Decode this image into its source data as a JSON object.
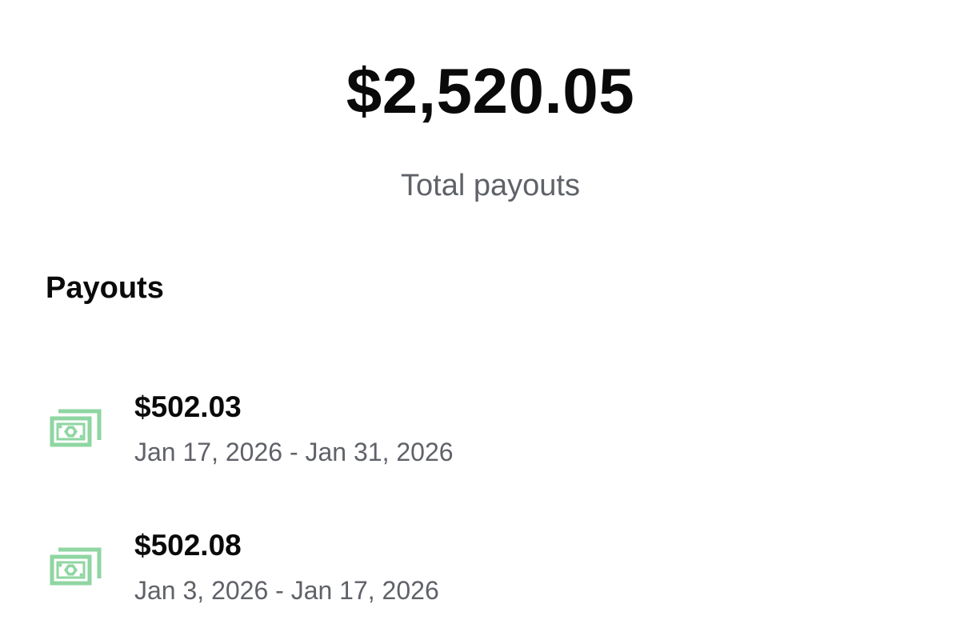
{
  "summary": {
    "total_amount": "$2,520.05",
    "total_label": "Total payouts"
  },
  "payouts_section": {
    "title": "Payouts",
    "items": [
      {
        "amount": "$502.03",
        "period": "Jan 17, 2026 - Jan 31, 2026",
        "icon": "cash-icon"
      },
      {
        "amount": "$502.08",
        "period": "Jan 3, 2026 - Jan 17, 2026",
        "icon": "cash-icon"
      }
    ]
  },
  "colors": {
    "cash_icon": "#8fd6a2",
    "primary_text": "#0a0a0a",
    "secondary_text": "#5f6268"
  }
}
